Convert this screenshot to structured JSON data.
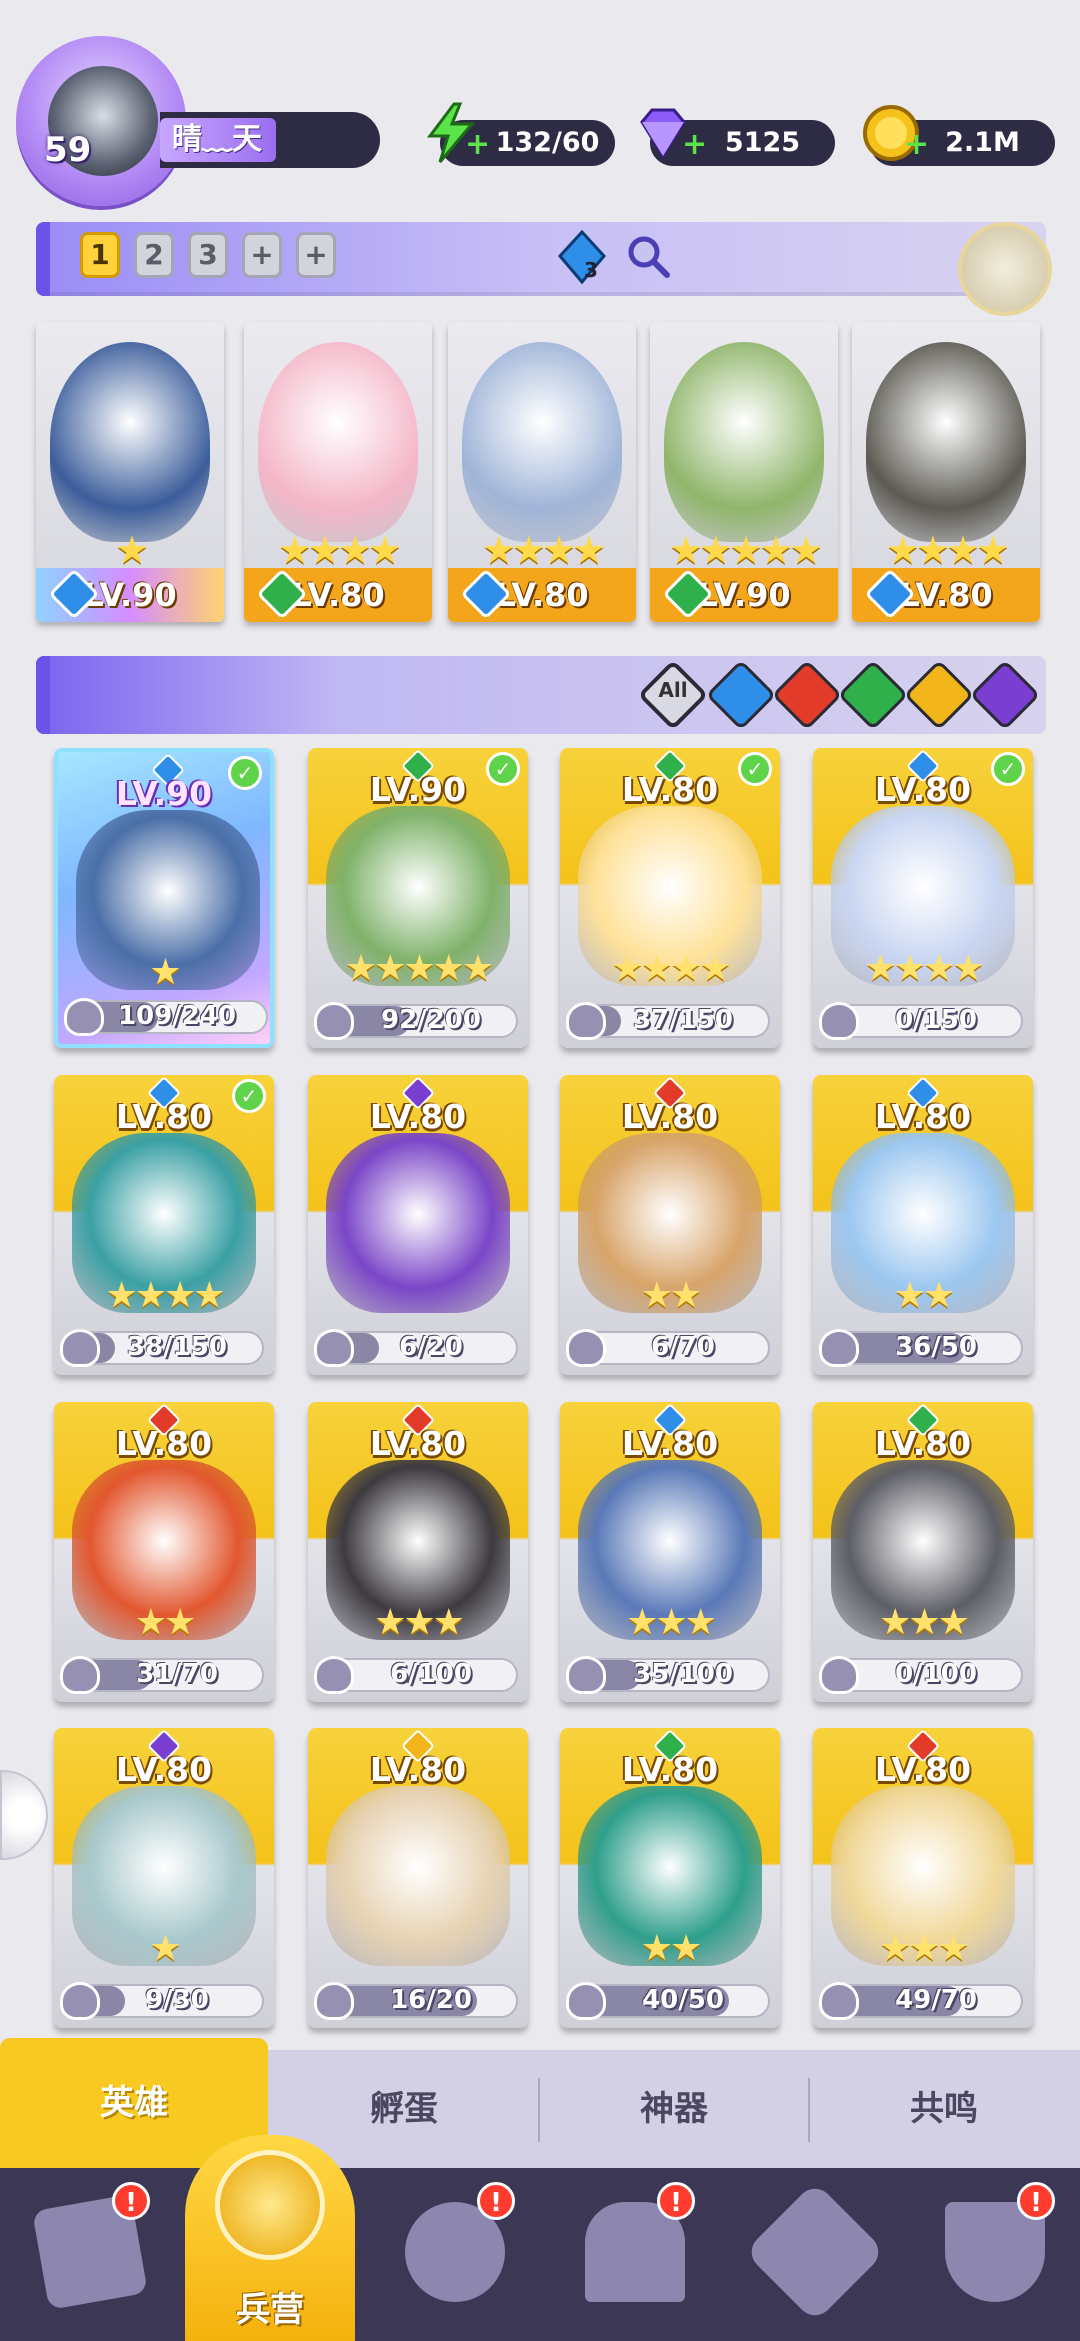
{
  "player": {
    "level": "59",
    "name": "晴﹏天"
  },
  "resources": [
    {
      "icon": "energy-icon",
      "value": "132/60",
      "color": "#5be34a"
    },
    {
      "icon": "gem-icon",
      "value": "5125",
      "color": "#8b5cf6"
    },
    {
      "icon": "gold-coin-icon",
      "value": "2.1M",
      "color": "#f5c21b"
    }
  ],
  "team_slots": [
    "1",
    "2",
    "3",
    "+",
    "+"
  ],
  "team_gem_count": "3",
  "team": [
    {
      "level": "LV.90",
      "stars": "★",
      "element": "water",
      "leader": true
    },
    {
      "level": "LV.80",
      "stars": "★★★★",
      "element": "wind",
      "leader": false
    },
    {
      "level": "LV.80",
      "stars": "★★★★",
      "element": "water",
      "leader": false
    },
    {
      "level": "LV.90",
      "stars": "★★★★★",
      "element": "wind",
      "leader": false
    },
    {
      "level": "LV.80",
      "stars": "★★★★",
      "element": "water",
      "leader": false
    }
  ],
  "filter": {
    "all_label": "All",
    "elements": [
      "water",
      "fire",
      "wind",
      "light",
      "dark"
    ]
  },
  "element_colors": {
    "water": "#2f8ee8",
    "fire": "#e23b2a",
    "wind": "#2fb04a",
    "light": "#f2b51a",
    "dark": "#7a3fd0"
  },
  "heroes": [
    {
      "level": "LV.90",
      "element": "water",
      "checked": true,
      "stars": "★",
      "shards": "109/240",
      "progress": 0.45,
      "leader": true
    },
    {
      "level": "LV.90",
      "element": "wind",
      "checked": true,
      "stars": "★★★★★",
      "shards": "92/200",
      "progress": 0.46,
      "leader": false
    },
    {
      "level": "LV.80",
      "element": "wind",
      "checked": true,
      "stars": "★★★★",
      "shards": "37/150",
      "progress": 0.25,
      "leader": false
    },
    {
      "level": "LV.80",
      "element": "water",
      "checked": true,
      "stars": "★★★★",
      "shards": "0/150",
      "progress": 0.0,
      "leader": false
    },
    {
      "level": "LV.80",
      "element": "water",
      "checked": true,
      "stars": "★★★★",
      "shards": "38/150",
      "progress": 0.25,
      "leader": false
    },
    {
      "level": "LV.80",
      "element": "dark",
      "checked": false,
      "stars": "",
      "shards": "6/20",
      "progress": 0.3,
      "leader": false
    },
    {
      "level": "LV.80",
      "element": "fire",
      "checked": false,
      "stars": "★★",
      "shards": "6/70",
      "progress": 0.09,
      "leader": false
    },
    {
      "level": "LV.80",
      "element": "water",
      "checked": false,
      "stars": "★★",
      "shards": "36/50",
      "progress": 0.72,
      "leader": false
    },
    {
      "level": "LV.80",
      "element": "fire",
      "checked": false,
      "stars": "★★",
      "shards": "31/70",
      "progress": 0.44,
      "leader": false
    },
    {
      "level": "LV.80",
      "element": "fire",
      "checked": false,
      "stars": "★★★",
      "shards": "6/100",
      "progress": 0.06,
      "leader": false
    },
    {
      "level": "LV.80",
      "element": "water",
      "checked": false,
      "stars": "★★★",
      "shards": "35/100",
      "progress": 0.35,
      "leader": false
    },
    {
      "level": "LV.80",
      "element": "wind",
      "checked": false,
      "stars": "★★★",
      "shards": "0/100",
      "progress": 0.0,
      "leader": false
    },
    {
      "level": "LV.80",
      "element": "dark",
      "checked": false,
      "stars": "★",
      "shards": "9/30",
      "progress": 0.3,
      "leader": false
    },
    {
      "level": "LV.80",
      "element": "light",
      "checked": false,
      "stars": "",
      "shards": "16/20",
      "progress": 0.8,
      "leader": false
    },
    {
      "level": "LV.80",
      "element": "wind",
      "checked": false,
      "stars": "★★",
      "shards": "40/50",
      "progress": 0.8,
      "leader": false
    },
    {
      "level": "LV.80",
      "element": "fire",
      "checked": false,
      "stars": "★★★",
      "shards": "49/70",
      "progress": 0.7,
      "leader": false
    }
  ],
  "subtabs": [
    "英雄",
    "孵蛋",
    "神器",
    "共鸣"
  ],
  "nav": [
    {
      "icon": "cards-icon",
      "badge": "!"
    },
    {
      "icon": "barracks-icon",
      "label": "兵营",
      "active": true
    },
    {
      "icon": "map-icon",
      "badge": "!"
    },
    {
      "icon": "castle-icon",
      "badge": "!"
    },
    {
      "icon": "mushroom-icon"
    },
    {
      "icon": "banner-icon",
      "badge": "!"
    }
  ]
}
